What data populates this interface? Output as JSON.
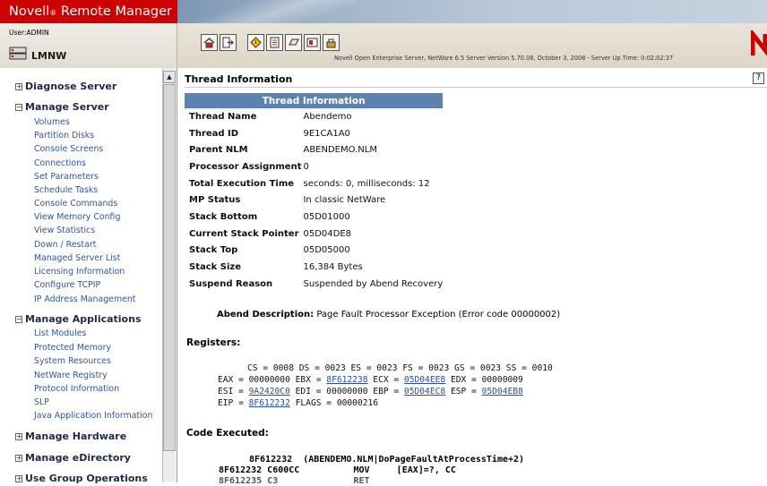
{
  "app": {
    "brand": "Novell",
    "brand_mark": "®",
    "brand_suffix": " Remote Manager",
    "user_label": "User:ADMIN",
    "server_name": "LMNW",
    "server_info": "Novell Open Enterprise Server, NetWare 6.5  Server Version 5.70.08, October 3, 2008 - Server Up Time: 0:02:02:37"
  },
  "toolbar": {
    "group1": [
      "home-icon",
      "exit-icon"
    ],
    "group2": [
      "health-icon",
      "config-icon",
      "volume-icon",
      "console-icon",
      "admin-icon"
    ]
  },
  "sidebar": {
    "sections": [
      {
        "label": "Diagnose Server",
        "toggle": "+",
        "links": []
      },
      {
        "label": "Manage Server",
        "toggle": "−",
        "links": [
          "Volumes",
          "Partition Disks",
          "Console Screens",
          "Connections",
          "Set Parameters",
          "Schedule Tasks",
          "Console Commands",
          "View Memory Config",
          "View Statistics",
          "Down / Restart",
          "Managed Server List",
          "Licensing Information",
          "Configure TCPIP",
          "IP Address Management"
        ]
      },
      {
        "label": "Manage Applications",
        "toggle": "−",
        "links": [
          "List Modules",
          "Protected Memory",
          "System Resources",
          "NetWare Registry",
          "Protocol Information",
          "SLP",
          "Java Application Information"
        ]
      },
      {
        "label": "Manage Hardware",
        "toggle": "+",
        "links": []
      },
      {
        "label": "Manage eDirectory",
        "toggle": "+",
        "links": []
      },
      {
        "label": "Use Group Operations",
        "toggle": "+",
        "links": []
      }
    ]
  },
  "main": {
    "page_title": "Thread Information",
    "table_header": "Thread Information",
    "rows": [
      {
        "key": "Thread Name",
        "value": "Abendemo"
      },
      {
        "key": "Thread ID",
        "value": "9E1CA1A0"
      },
      {
        "key": "Parent NLM",
        "value": "ABENDEMO.NLM"
      },
      {
        "key": "Processor Assignment",
        "value": "0"
      },
      {
        "key": "Total Execution Time",
        "value": "seconds: 0, milliseconds: 12"
      },
      {
        "key": "MP Status",
        "value": "In classic NetWare"
      },
      {
        "key": "Stack Bottom",
        "value": "05D01000"
      },
      {
        "key": "Current Stack Pointer",
        "value": "05D04DE8"
      },
      {
        "key": "Stack Top",
        "value": "05D05000"
      },
      {
        "key": "Stack Size",
        "value": "16,384 Bytes"
      },
      {
        "key": "Suspend Reason",
        "value": "Suspended by Abend Recovery"
      }
    ],
    "abend_label": "Abend Description:",
    "abend_value": "Page Fault Processor Exception (Error code 00000002)",
    "registers_label": "Registers:",
    "registers": {
      "line1": "CS = 0008 DS = 0023 ES = 0023 FS = 0023 GS = 0023 SS = 0010",
      "eax_pre": "EAX = 00000000 EBX = ",
      "ebx": "8F612238",
      "ecx_pre": " ECX = ",
      "ecx": "05D04EE8",
      "edx_rest": " EDX = 00000009",
      "esi_pre": "ESI = ",
      "esi": "9A2420C0",
      "edi_rest": " EDI = 00000000 EBP = ",
      "ebp": "05D04EC8",
      "esp_pre": " ESP = ",
      "esp": "05D04EB8",
      "eip_pre": "EIP = ",
      "eip": "8F612232",
      "flags_rest": " FLAGS = 00000216"
    },
    "code_label": "Code Executed:",
    "code_line1": "8F612232  (ABENDEMO.NLM|DoPageFaultAtProcessTime+2)",
    "code_line2": "8F612232 C600CC          MOV     [EAX]=?, CC",
    "code_line3": "8F612235 C3              RET"
  },
  "colors": {
    "brand_red": "#cc0000",
    "table_header": "#5c82ad",
    "link_blue": "#3056a0",
    "section_navy": "#1f2a44"
  }
}
